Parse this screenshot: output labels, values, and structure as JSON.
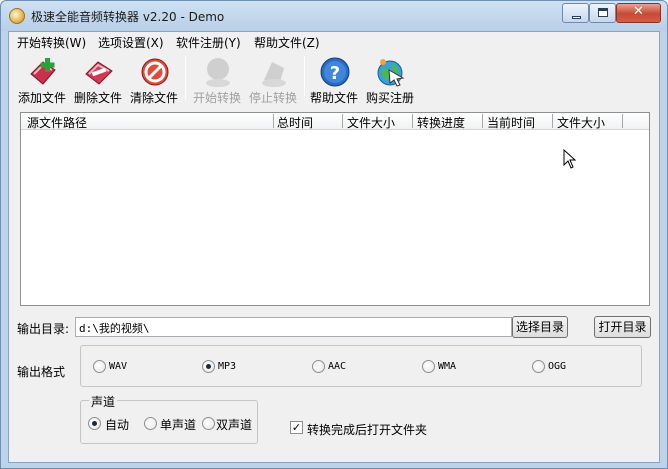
{
  "window": {
    "title": "极速全能音频转换器 v2.20 - Demo",
    "close_glyph": "✕"
  },
  "menu": [
    "开始转换(W)",
    "选项设置(X)",
    "软件注册(Y)",
    "帮助文件(Z)"
  ],
  "toolbar": [
    {
      "label": "添加文件",
      "icon": "add-file-icon",
      "enabled": true
    },
    {
      "label": "删除文件",
      "icon": "delete-file-icon",
      "enabled": true
    },
    {
      "label": "清除文件",
      "icon": "clear-files-icon",
      "enabled": true
    },
    {
      "label": "开始转换",
      "icon": "start-convert-icon",
      "enabled": false
    },
    {
      "label": "停止转换",
      "icon": "stop-convert-icon",
      "enabled": false
    },
    {
      "label": "帮助文件",
      "icon": "help-icon",
      "enabled": true
    },
    {
      "label": "购买注册",
      "icon": "buy-register-icon",
      "enabled": true
    }
  ],
  "file_list": {
    "columns": [
      "源文件路径",
      "总时间",
      "文件大小",
      "转换进度",
      "当前时间",
      "文件大小"
    ],
    "rows": []
  },
  "output": {
    "dir_label": "输出目录:",
    "dir_value": "d:\\我的视频\\",
    "choose_dir_button": "选择目录",
    "open_dir_button": "打开目录"
  },
  "format": {
    "label": "输出格式",
    "options": [
      "WAV",
      "MP3",
      "AAC",
      "WMA",
      "OGG"
    ],
    "selected": "MP3"
  },
  "channel": {
    "label": "声道",
    "options": [
      "自动",
      "单声道",
      "双声道"
    ],
    "selected": "自动"
  },
  "open_folder_after": {
    "label": "转换完成后打开文件夹",
    "checked": true,
    "check_glyph": "✓"
  },
  "colors": {
    "titlebar": "#bcd3ea",
    "close_button": "#c74a35",
    "disabled_text": "#a0a0a0"
  }
}
